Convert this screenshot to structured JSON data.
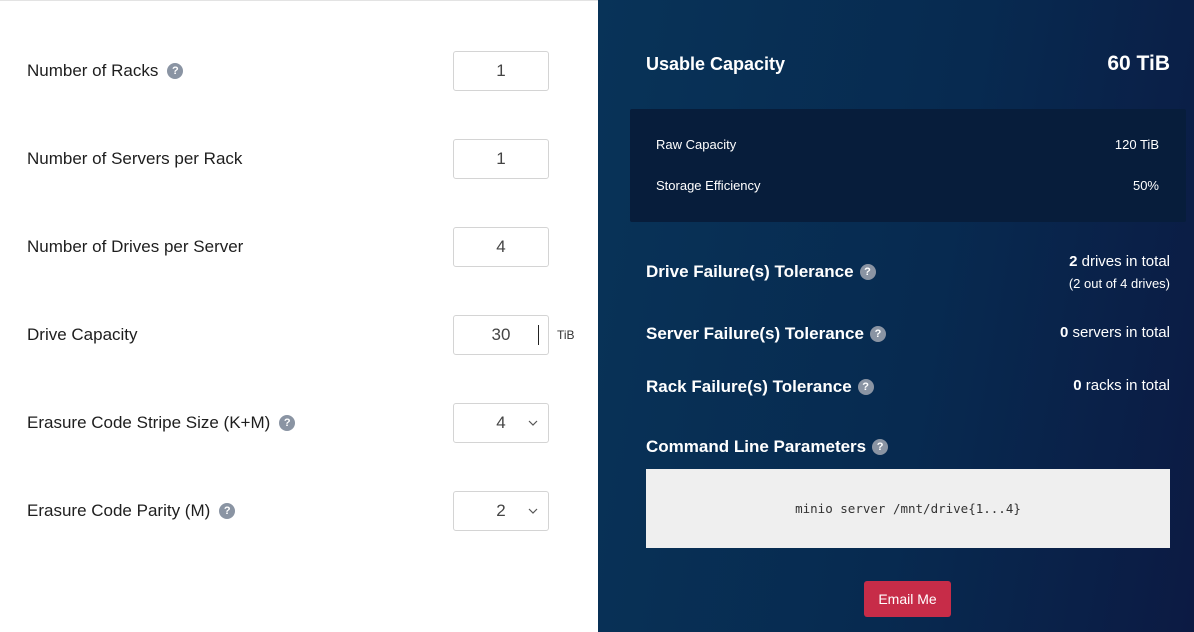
{
  "form": {
    "racks": {
      "label": "Number of Racks",
      "value": "1"
    },
    "servers": {
      "label": "Number of Servers per Rack",
      "value": "1"
    },
    "drives": {
      "label": "Number of Drives per Server",
      "value": "4"
    },
    "capacity": {
      "label": "Drive Capacity",
      "value": "30",
      "unit": "TiB"
    },
    "stripe": {
      "label": "Erasure Code Stripe Size (K+M)",
      "value": "4"
    },
    "parity": {
      "label": "Erasure Code Parity (M)",
      "value": "2"
    },
    "help_glyph": "?"
  },
  "results": {
    "usable": {
      "label": "Usable Capacity",
      "value": "60 TiB"
    },
    "raw": {
      "label": "Raw Capacity",
      "value": "120 TiB"
    },
    "efficiency": {
      "label": "Storage Efficiency",
      "value": "50%"
    },
    "drive_tolerance": {
      "label": "Drive Failure(s) Tolerance",
      "count": "2",
      "suffix": " drives in total",
      "detail": "(2 out of 4 drives)"
    },
    "server_tolerance": {
      "label": "Server Failure(s) Tolerance",
      "count": "0",
      "suffix": " servers in total"
    },
    "rack_tolerance": {
      "label": "Rack Failure(s) Tolerance",
      "count": "0",
      "suffix": " racks in total"
    },
    "cmd": {
      "label": "Command Line Parameters",
      "value": "minio server /mnt/drive{1...4}"
    },
    "email_button": "Email Me"
  },
  "colors": {
    "panel_bg": "#072a50",
    "raw_box_bg": "#071d3b",
    "accent_button": "#c72c48",
    "help_icon": "#8a94a3"
  }
}
